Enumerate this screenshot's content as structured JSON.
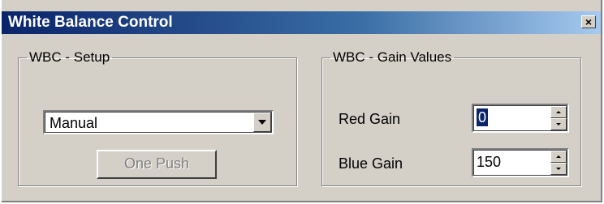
{
  "window": {
    "title": "White Balance Control",
    "close_glyph": "×"
  },
  "setup": {
    "legend": "WBC - Setup",
    "mode_selected": "Manual",
    "one_push_label": "One Push",
    "one_push_enabled": false
  },
  "gain": {
    "legend": "WBC - Gain Values",
    "red_label": "Red Gain",
    "red_value": "0",
    "blue_label": "Blue Gain",
    "blue_value": "150"
  },
  "colors": {
    "title_gradient_start": "#0a246a",
    "title_gradient_end": "#a6caf0",
    "dialog_face": "#d4d0c8",
    "selection": "#0a246a"
  },
  "icons": {
    "close": "close-icon",
    "dropdown": "chevron-down-icon",
    "spin_up": "spin-up-icon",
    "spin_down": "spin-down-icon"
  }
}
